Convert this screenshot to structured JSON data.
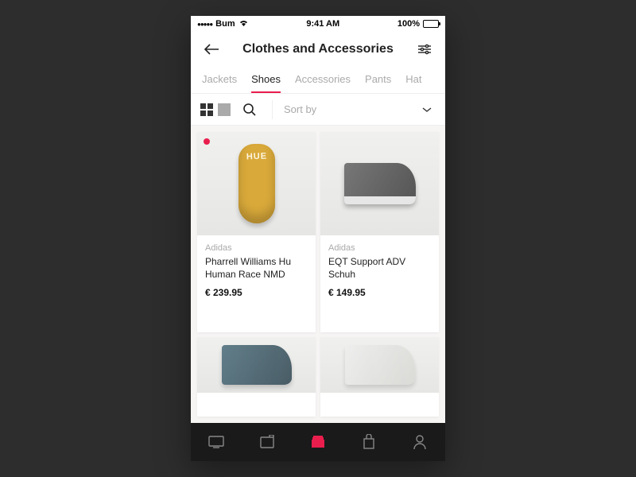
{
  "status": {
    "carrier": "Bum",
    "time": "9:41 AM",
    "battery_pct": "100%"
  },
  "header": {
    "title": "Clothes and Accessories"
  },
  "tabs": [
    "Jackets",
    "Shoes",
    "Accessories",
    "Pants",
    "Hat"
  ],
  "active_tab_index": 1,
  "sort": {
    "label": "Sort by"
  },
  "products": [
    {
      "brand": "Adidas",
      "name": "Pharrell Williams Hu Human Race NMD",
      "price": "€ 239.95",
      "new": true
    },
    {
      "brand": "Adidas",
      "name": "EQT Support ADV Schuh",
      "price": "€ 149.95",
      "new": false
    }
  ],
  "colors": {
    "accent": "#e91e4d"
  }
}
